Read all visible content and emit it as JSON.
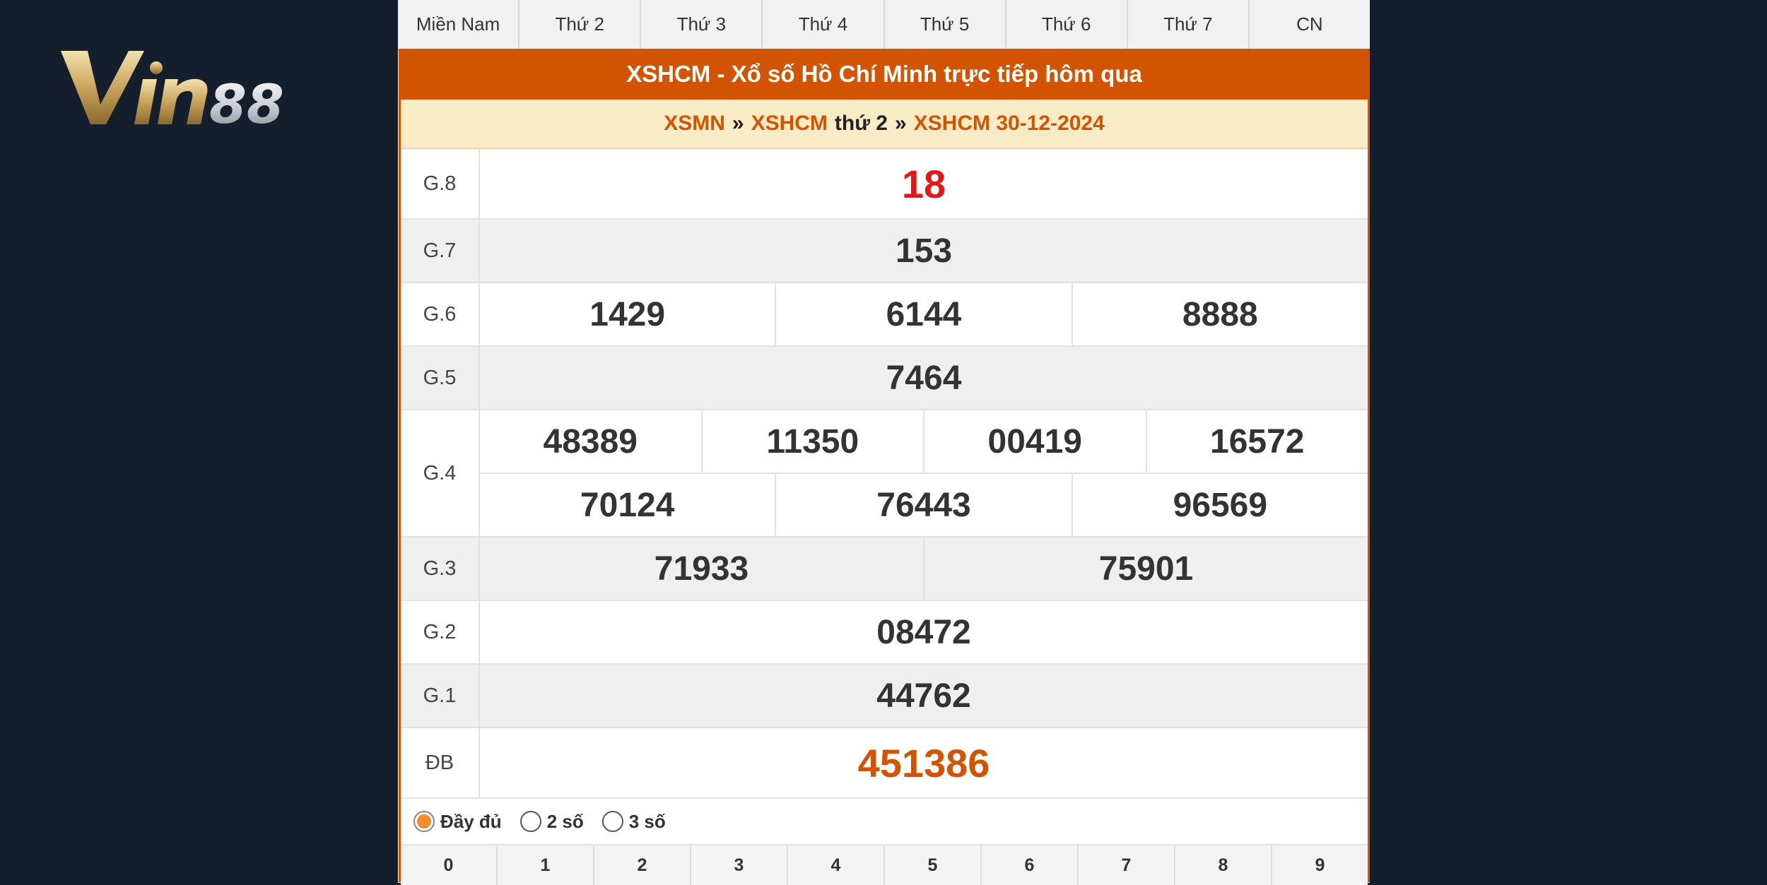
{
  "logo": {
    "text": "Vin88"
  },
  "tabs": [
    "Miền Nam",
    "Thứ 2",
    "Thứ 3",
    "Thứ 4",
    "Thứ 5",
    "Thứ 6",
    "Thứ 7",
    "CN"
  ],
  "title": "XSHCM - Xổ số Hồ Chí Minh trực tiếp hôm qua",
  "breadcrumb": {
    "l1": "XSMN",
    "sep1": "»",
    "l2": "XSHCM",
    "day": "thứ 2",
    "sep2": "»",
    "l3": "XSHCM 30-12-2024"
  },
  "prizes": {
    "g8": {
      "label": "G.8",
      "values": [
        "18"
      ]
    },
    "g7": {
      "label": "G.7",
      "values": [
        "153"
      ]
    },
    "g6": {
      "label": "G.6",
      "values": [
        "1429",
        "6144",
        "8888"
      ]
    },
    "g5": {
      "label": "G.5",
      "values": [
        "7464"
      ]
    },
    "g4": {
      "label": "G.4",
      "values": [
        "48389",
        "11350",
        "00419",
        "16572",
        "70124",
        "76443",
        "96569"
      ]
    },
    "g3": {
      "label": "G.3",
      "values": [
        "71933",
        "75901"
      ]
    },
    "g2": {
      "label": "G.2",
      "values": [
        "08472"
      ]
    },
    "g1": {
      "label": "G.1",
      "values": [
        "44762"
      ]
    },
    "db": {
      "label": "ĐB",
      "values": [
        "451386"
      ]
    }
  },
  "options": {
    "full": "Đầy đủ",
    "two": "2 số",
    "three": "3 số",
    "selected": "full"
  },
  "digits": [
    "0",
    "1",
    "2",
    "3",
    "4",
    "5",
    "6",
    "7",
    "8",
    "9"
  ],
  "colors": {
    "accent": "#d35400",
    "highlight": "#e01818",
    "crumb_bg": "#f9ebc6",
    "background": "#151e2d"
  }
}
